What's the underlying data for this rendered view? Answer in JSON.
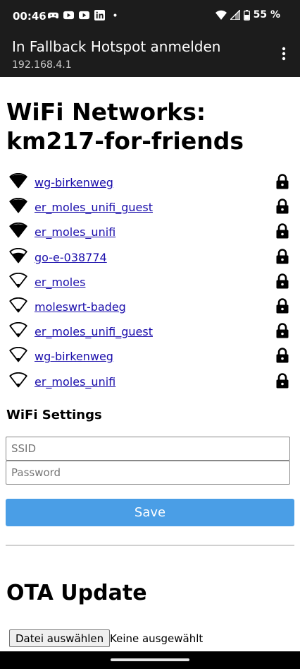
{
  "status_bar": {
    "time": "00:46",
    "battery": "55 %",
    "notification_icons": [
      "game-controller-icon",
      "youtube-icon",
      "youtube-icon",
      "linkedin-icon",
      "dot-icon"
    ]
  },
  "app_bar": {
    "title": "In Fallback Hotspot anmelden",
    "subtitle": "192.168.4.1"
  },
  "page": {
    "title": "WiFi Networks: km217-for-friends",
    "networks": [
      {
        "ssid": "wg-birkenweg",
        "signal": 4,
        "secured": true
      },
      {
        "ssid": "er_moles_unifi_guest",
        "signal": 4,
        "secured": true
      },
      {
        "ssid": "er_moles_unifi",
        "signal": 4,
        "secured": true
      },
      {
        "ssid": "go-e-038774",
        "signal": 3,
        "secured": true
      },
      {
        "ssid": "er_moles",
        "signal": 1,
        "secured": true
      },
      {
        "ssid": "moleswrt-badeg",
        "signal": 1,
        "secured": true
      },
      {
        "ssid": "er_moles_unifi_guest",
        "signal": 1,
        "secured": true
      },
      {
        "ssid": "wg-birkenweg",
        "signal": 1,
        "secured": true
      },
      {
        "ssid": "er_moles_unifi",
        "signal": 1,
        "secured": true
      }
    ],
    "settings_heading": "WiFi Settings",
    "ssid_placeholder": "SSID",
    "password_placeholder": "Password",
    "save_label": "Save",
    "ota_heading": "OTA Update",
    "file_button_label": "Datei auswählen",
    "file_status": "Keine ausgewählt"
  },
  "colors": {
    "link": "#1a0dab",
    "button": "#4a9ee6",
    "app_bar": "#1c1c1c"
  }
}
